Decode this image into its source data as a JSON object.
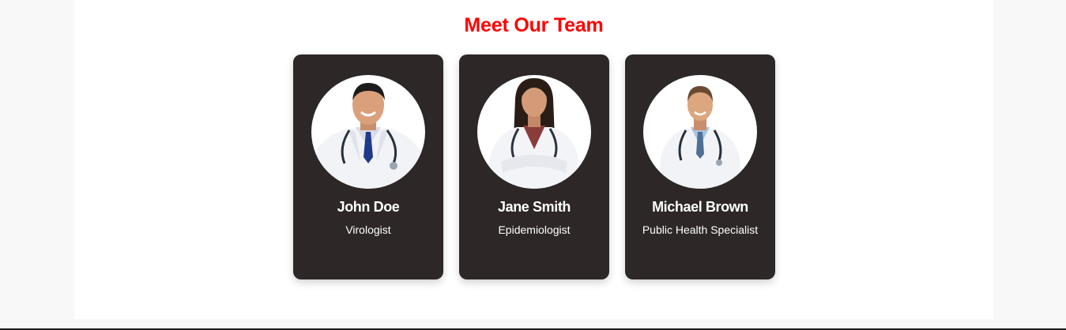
{
  "section": {
    "title": "Meet Our Team",
    "title_color": "#ff0000",
    "card_color": "#2d2727"
  },
  "team": [
    {
      "name": "John Doe",
      "role": "Virologist",
      "photo_icon": "male-doctor-portrait"
    },
    {
      "name": "Jane Smith",
      "role": "Epidemiologist",
      "photo_icon": "female-doctor-portrait"
    },
    {
      "name": "Michael Brown",
      "role": "Public Health Specialist",
      "photo_icon": "male-doctor-portrait"
    }
  ]
}
